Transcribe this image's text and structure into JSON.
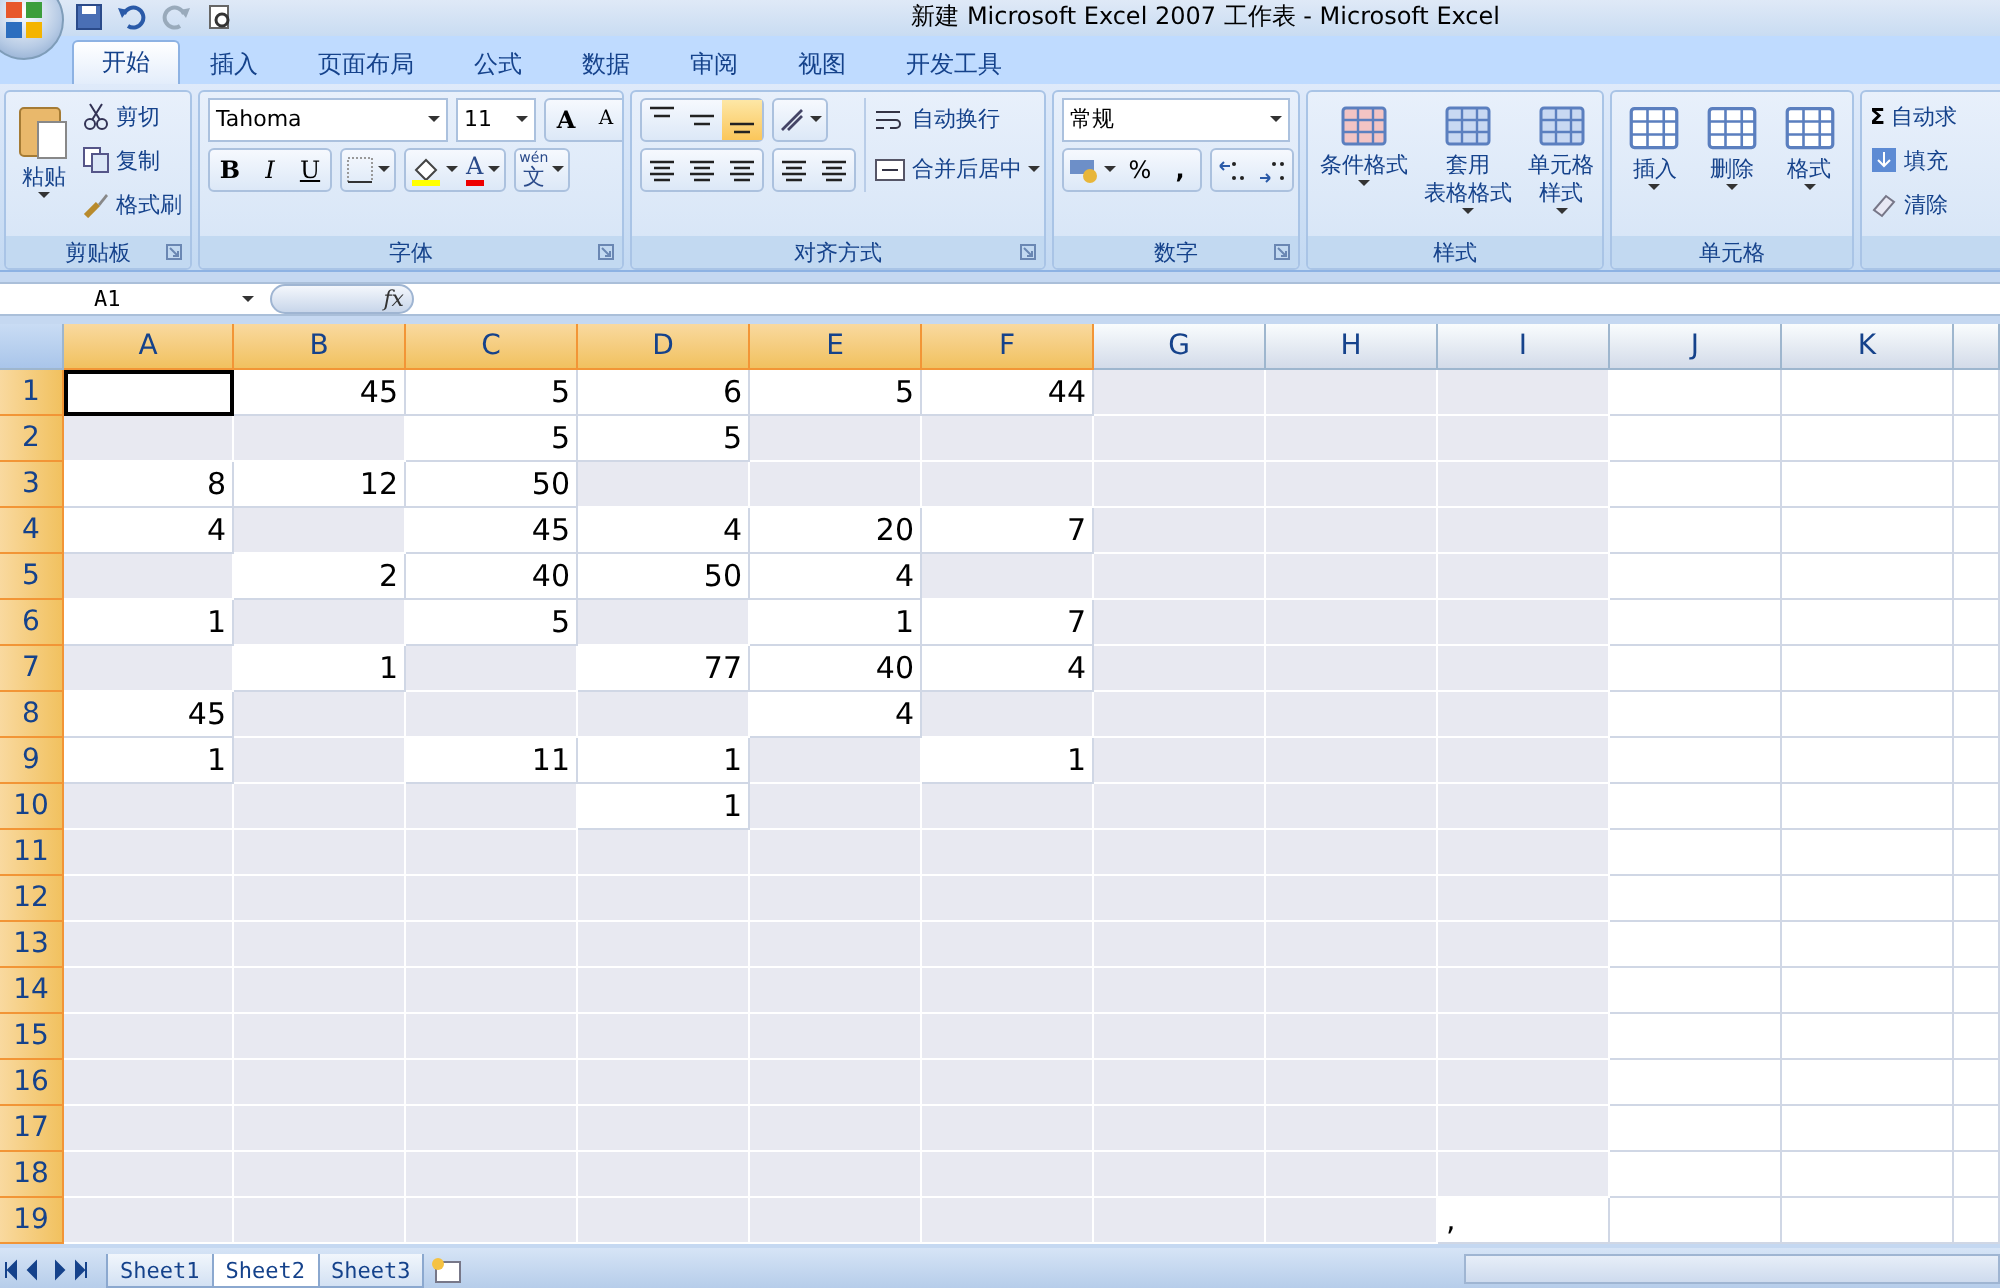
{
  "window": {
    "title": "新建 Microsoft Excel 2007 工作表 - Microsoft Excel"
  },
  "tabs": [
    {
      "label": "开始",
      "selected": true
    },
    {
      "label": "插入",
      "selected": false
    },
    {
      "label": "页面布局",
      "selected": false
    },
    {
      "label": "公式",
      "selected": false
    },
    {
      "label": "数据",
      "selected": false
    },
    {
      "label": "审阅",
      "selected": false
    },
    {
      "label": "视图",
      "selected": false
    },
    {
      "label": "开发工具",
      "selected": false
    }
  ],
  "clipboard": {
    "paste": "粘贴",
    "items": [
      "剪切",
      "复制",
      "格式刷"
    ],
    "label": "剪贴板"
  },
  "font": {
    "name": "Tahoma",
    "size": "11",
    "grow": "A",
    "shrink": "A",
    "bold": "B",
    "italic": "I",
    "underline": "U",
    "color_letter": "A",
    "phonetic_top": "wén",
    "phonetic": "文",
    "label": "字体"
  },
  "alignment": {
    "vertical": [
      {
        "selected": false
      },
      {
        "selected": false
      },
      {
        "selected": true
      }
    ],
    "wrap": "自动换行",
    "merge": "合并后居中",
    "label": "对齐方式"
  },
  "number": {
    "format": "常规",
    "percent": "%",
    "comma": ",",
    "label": "数字"
  },
  "styles": {
    "items": [
      {
        "lines": [
          "条件格式"
        ]
      },
      {
        "lines": [
          "套用",
          "表格格式"
        ]
      },
      {
        "lines": [
          "单元格",
          "样式"
        ]
      }
    ],
    "label": "样式"
  },
  "cells_group": {
    "items": [
      "插入",
      "删除",
      "格式"
    ],
    "label": "单元格"
  },
  "editing": {
    "sum_sign": "Σ",
    "items": [
      "自动求",
      "填充",
      "清除"
    ]
  },
  "formula_bar": {
    "name_box": "A1",
    "fx": "fx"
  },
  "columns": [
    "A",
    "B",
    "C",
    "D",
    "E",
    "F",
    "G",
    "H",
    "I",
    "J",
    "K"
  ],
  "rows": [
    {
      "label": "1",
      "cells": [
        {
          "selected": true,
          "shaded": false
        },
        {
          "value": "45",
          "selected": false,
          "shaded": false
        },
        {
          "value": "5",
          "selected": false,
          "shaded": false
        },
        {
          "value": "6",
          "selected": false,
          "shaded": false
        },
        {
          "value": "5",
          "selected": false,
          "shaded": false
        },
        {
          "value": "44",
          "selected": false,
          "shaded": false
        },
        {
          "selected": false,
          "shaded": true
        },
        {
          "selected": false,
          "shaded": true
        },
        {
          "selected": false,
          "shaded": true
        }
      ]
    },
    {
      "label": "2",
      "cells": [
        {
          "selected": false,
          "shaded": true
        },
        {
          "selected": false,
          "shaded": true
        },
        {
          "value": "5",
          "selected": false,
          "shaded": false
        },
        {
          "value": "5",
          "selected": false,
          "shaded": false
        },
        {
          "selected": false,
          "shaded": true
        },
        {
          "selected": false,
          "shaded": true
        },
        {
          "selected": false,
          "shaded": true
        },
        {
          "selected": false,
          "shaded": true
        },
        {
          "selected": false,
          "shaded": true
        }
      ]
    },
    {
      "label": "3",
      "cells": [
        {
          "value": "8",
          "selected": false,
          "shaded": false
        },
        {
          "value": "12",
          "selected": false,
          "shaded": false
        },
        {
          "value": "50",
          "selected": false,
          "shaded": false
        },
        {
          "selected": false,
          "shaded": true
        },
        {
          "selected": false,
          "shaded": true
        },
        {
          "selected": false,
          "shaded": true
        },
        {
          "selected": false,
          "shaded": true
        },
        {
          "selected": false,
          "shaded": true
        },
        {
          "selected": false,
          "shaded": true
        }
      ]
    },
    {
      "label": "4",
      "cells": [
        {
          "value": "4",
          "selected": false,
          "shaded": false
        },
        {
          "selected": false,
          "shaded": true
        },
        {
          "value": "45",
          "selected": false,
          "shaded": false
        },
        {
          "value": "4",
          "selected": false,
          "shaded": false
        },
        {
          "value": "20",
          "selected": false,
          "shaded": false
        },
        {
          "value": "7",
          "selected": false,
          "shaded": false
        },
        {
          "selected": false,
          "shaded": true
        },
        {
          "selected": false,
          "shaded": true
        },
        {
          "selected": false,
          "shaded": true
        }
      ]
    },
    {
      "label": "5",
      "cells": [
        {
          "selected": false,
          "shaded": true
        },
        {
          "value": "2",
          "selected": false,
          "shaded": false
        },
        {
          "value": "40",
          "selected": false,
          "shaded": false
        },
        {
          "value": "50",
          "selected": false,
          "shaded": false
        },
        {
          "value": "4",
          "selected": false,
          "shaded": false
        },
        {
          "selected": false,
          "shaded": true
        },
        {
          "selected": false,
          "shaded": true
        },
        {
          "selected": false,
          "shaded": true
        },
        {
          "selected": false,
          "shaded": true
        }
      ]
    },
    {
      "label": "6",
      "cells": [
        {
          "value": "1",
          "selected": false,
          "shaded": false
        },
        {
          "selected": false,
          "shaded": true
        },
        {
          "value": "5",
          "selected": false,
          "shaded": false
        },
        {
          "selected": false,
          "shaded": true
        },
        {
          "value": "1",
          "selected": false,
          "shaded": false
        },
        {
          "value": "7",
          "selected": false,
          "shaded": false
        },
        {
          "selected": false,
          "shaded": true
        },
        {
          "selected": false,
          "shaded": true
        },
        {
          "selected": false,
          "shaded": true
        }
      ]
    },
    {
      "label": "7",
      "cells": [
        {
          "selected": false,
          "shaded": true
        },
        {
          "value": "1",
          "selected": false,
          "shaded": false
        },
        {
          "selected": false,
          "shaded": true
        },
        {
          "value": "77",
          "selected": false,
          "shaded": false
        },
        {
          "value": "40",
          "selected": false,
          "shaded": false
        },
        {
          "value": "4",
          "selected": false,
          "shaded": false
        },
        {
          "selected": false,
          "shaded": true
        },
        {
          "selected": false,
          "shaded": true
        },
        {
          "selected": false,
          "shaded": true
        }
      ]
    },
    {
      "label": "8",
      "cells": [
        {
          "value": "45",
          "selected": false,
          "shaded": false
        },
        {
          "selected": false,
          "shaded": true
        },
        {
          "selected": false,
          "shaded": true
        },
        {
          "selected": false,
          "shaded": true
        },
        {
          "value": "4",
          "selected": false,
          "shaded": false
        },
        {
          "selected": false,
          "shaded": true
        },
        {
          "selected": false,
          "shaded": true
        },
        {
          "selected": false,
          "shaded": true
        },
        {
          "selected": false,
          "shaded": true
        }
      ]
    },
    {
      "label": "9",
      "cells": [
        {
          "value": "1",
          "selected": false,
          "shaded": false
        },
        {
          "selected": false,
          "shaded": true
        },
        {
          "value": "11",
          "selected": false,
          "shaded": false
        },
        {
          "value": "1",
          "selected": false,
          "shaded": false
        },
        {
          "selected": false,
          "shaded": true
        },
        {
          "value": "1",
          "selected": false,
          "shaded": false
        },
        {
          "selected": false,
          "shaded": true
        },
        {
          "selected": false,
          "shaded": true
        },
        {
          "selected": false,
          "shaded": true
        }
      ]
    },
    {
      "label": "10",
      "cells": [
        {
          "selected": false,
          "shaded": true
        },
        {
          "selected": false,
          "shaded": true
        },
        {
          "selected": false,
          "shaded": true
        },
        {
          "value": "1",
          "selected": false,
          "shaded": false
        },
        {
          "selected": false,
          "shaded": true
        },
        {
          "selected": false,
          "shaded": true
        },
        {
          "selected": false,
          "shaded": true
        },
        {
          "selected": false,
          "shaded": true
        },
        {
          "selected": false,
          "shaded": true
        }
      ]
    },
    {
      "label": "11",
      "cells": [
        {
          "selected": false,
          "shaded": true
        },
        {
          "selected": false,
          "shaded": true
        },
        {
          "selected": false,
          "shaded": true
        },
        {
          "selected": false,
          "shaded": true
        },
        {
          "selected": false,
          "shaded": true
        },
        {
          "selected": false,
          "shaded": true
        },
        {
          "selected": false,
          "shaded": true
        },
        {
          "selected": false,
          "shaded": true
        },
        {
          "selected": false,
          "shaded": true
        }
      ]
    },
    {
      "label": "12",
      "cells": [
        {
          "selected": false,
          "shaded": true
        },
        {
          "selected": false,
          "shaded": true
        },
        {
          "selected": false,
          "shaded": true
        },
        {
          "selected": false,
          "shaded": true
        },
        {
          "selected": false,
          "shaded": true
        },
        {
          "selected": false,
          "shaded": true
        },
        {
          "selected": false,
          "shaded": true
        },
        {
          "selected": false,
          "shaded": true
        },
        {
          "selected": false,
          "shaded": true
        }
      ]
    },
    {
      "label": "13",
      "cells": [
        {
          "selected": false,
          "shaded": true
        },
        {
          "selected": false,
          "shaded": true
        },
        {
          "selected": false,
          "shaded": true
        },
        {
          "selected": false,
          "shaded": true
        },
        {
          "selected": false,
          "shaded": true
        },
        {
          "selected": false,
          "shaded": true
        },
        {
          "selected": false,
          "shaded": true
        },
        {
          "selected": false,
          "shaded": true
        },
        {
          "selected": false,
          "shaded": true
        }
      ]
    },
    {
      "label": "14",
      "cells": [
        {
          "selected": false,
          "shaded": true
        },
        {
          "selected": false,
          "shaded": true
        },
        {
          "selected": false,
          "shaded": true
        },
        {
          "selected": false,
          "shaded": true
        },
        {
          "selected": false,
          "shaded": true
        },
        {
          "selected": false,
          "shaded": true
        },
        {
          "selected": false,
          "shaded": true
        },
        {
          "selected": false,
          "shaded": true
        },
        {
          "selected": false,
          "shaded": true
        }
      ]
    },
    {
      "label": "15",
      "cells": [
        {
          "selected": false,
          "shaded": true
        },
        {
          "selected": false,
          "shaded": true
        },
        {
          "selected": false,
          "shaded": true
        },
        {
          "selected": false,
          "shaded": true
        },
        {
          "selected": false,
          "shaded": true
        },
        {
          "selected": false,
          "shaded": true
        },
        {
          "selected": false,
          "shaded": true
        },
        {
          "selected": false,
          "shaded": true
        },
        {
          "selected": false,
          "shaded": true
        }
      ]
    },
    {
      "label": "16",
      "cells": [
        {
          "selected": false,
          "shaded": true
        },
        {
          "selected": false,
          "shaded": true
        },
        {
          "selected": false,
          "shaded": true
        },
        {
          "selected": false,
          "shaded": true
        },
        {
          "selected": false,
          "shaded": true
        },
        {
          "selected": false,
          "shaded": true
        },
        {
          "selected": false,
          "shaded": true
        },
        {
          "selected": false,
          "shaded": true
        },
        {
          "selected": false,
          "shaded": true
        }
      ]
    },
    {
      "label": "17",
      "cells": [
        {
          "selected": false,
          "shaded": true
        },
        {
          "selected": false,
          "shaded": true
        },
        {
          "selected": false,
          "shaded": true
        },
        {
          "selected": false,
          "shaded": true
        },
        {
          "selected": false,
          "shaded": true
        },
        {
          "selected": false,
          "shaded": true
        },
        {
          "selected": false,
          "shaded": true
        },
        {
          "selected": false,
          "shaded": true
        },
        {
          "selected": false,
          "shaded": true
        }
      ]
    },
    {
      "label": "18",
      "cells": [
        {
          "selected": false,
          "shaded": true
        },
        {
          "selected": false,
          "shaded": true
        },
        {
          "selected": false,
          "shaded": true
        },
        {
          "selected": false,
          "shaded": true
        },
        {
          "selected": false,
          "shaded": true
        },
        {
          "selected": false,
          "shaded": true
        },
        {
          "selected": false,
          "shaded": true
        },
        {
          "selected": false,
          "shaded": true
        },
        {
          "selected": false,
          "shaded": true
        }
      ]
    },
    {
      "label": "19",
      "cells": [
        {
          "selected": false,
          "shaded": true
        },
        {
          "selected": false,
          "shaded": true
        },
        {
          "selected": false,
          "shaded": true
        },
        {
          "selected": false,
          "shaded": true
        },
        {
          "selected": false,
          "shaded": true
        },
        {
          "selected": false,
          "shaded": true
        },
        {
          "selected": false,
          "shaded": true
        },
        {
          "selected": false,
          "shaded": true
        },
        {
          "value": ",",
          "selected": false,
          "shaded": false
        }
      ]
    }
  ],
  "sheets": [
    {
      "label": "Sheet1",
      "selected": false
    },
    {
      "label": "Sheet2",
      "selected": true
    },
    {
      "label": "Sheet3",
      "selected": false
    }
  ]
}
